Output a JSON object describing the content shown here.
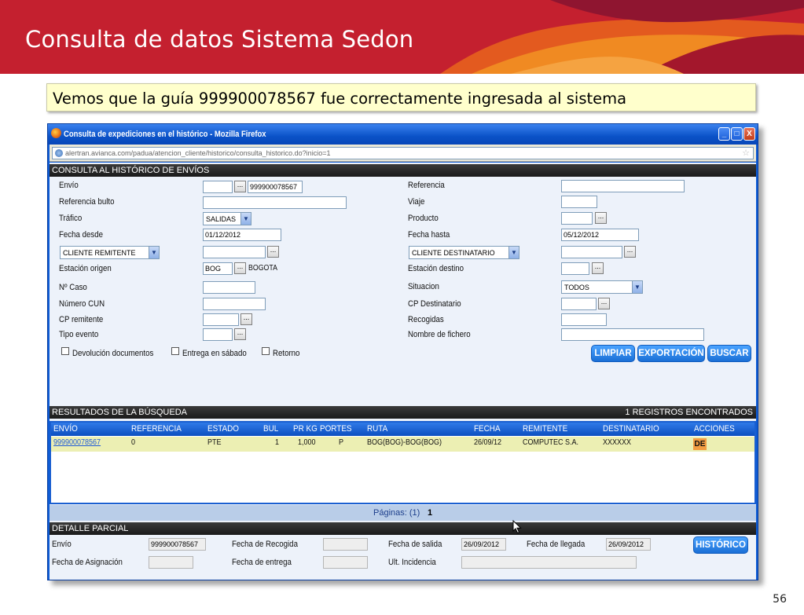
{
  "slide": {
    "title": "Consulta de datos Sistema Sedon",
    "callout": "Vemos que la guía 999900078567 fue correctamente ingresada al sistema",
    "page_number": "56"
  },
  "window": {
    "title": "Consulta de expediciones en el histórico - Mozilla Firefox",
    "url": "alertran.avianca.com/padua/atencion_cliente/historico/consulta_historico.do?inicio=1",
    "buttons": [
      "_",
      "□",
      "X"
    ]
  },
  "search": {
    "header": "CONSULTA AL HISTÓRICO DE ENVÍOS",
    "labels": {
      "envio": "Envío",
      "referencia_bulto": "Referencia bulto",
      "trafico": "Tráfico",
      "fecha_desde": "Fecha desde",
      "estacion_origen": "Estación origen",
      "n_caso": "Nº Caso",
      "numero_cun": "Número CUN",
      "cp_remitente": "CP remitente",
      "tipo_evento": "Tipo evento",
      "referencia": "Referencia",
      "viaje": "Viaje",
      "producto": "Producto",
      "fecha_hasta": "Fecha hasta",
      "estacion_destino": "Estación destino",
      "situacion": "Situacion",
      "cp_destinatario": "CP Destinatario",
      "recogidas": "Recogidas",
      "nombre_fichero": "Nombre de fichero"
    },
    "values": {
      "envio": "999900078567",
      "trafico": "SALIDAS",
      "fecha_desde": "01/12/2012",
      "fecha_hasta": "05/12/2012",
      "estacion_origen_code": "BOG",
      "estacion_origen_name": "BOGOTA",
      "situacion": "TODOS",
      "cliente_remitente": "CLIENTE REMITENTE",
      "cliente_destinatario": "CLIENTE DESTINATARIO"
    },
    "checkboxes": [
      "Devolución documentos",
      "Entrega en sábado",
      "Retorno"
    ],
    "dots_label": "...",
    "buttons": {
      "limpiar": "LIMPIAR",
      "exportacion": "EXPORTACIÓN",
      "buscar": "BUSCAR"
    }
  },
  "results": {
    "header": "RESULTADOS DE LA BÚSQUEDA",
    "count": "1 REGISTROS ENCONTRADOS",
    "columns": [
      "ENVÍO",
      "REFERENCIA",
      "ESTADO",
      "BUL",
      "PR KG",
      "PORTES",
      "RUTA",
      "FECHA",
      "REMITENTE",
      "DESTINATARIO",
      "ACCIONES"
    ],
    "rows": [
      [
        "999900078567",
        "0",
        "PTE",
        "1",
        "1,000",
        "P",
        "BOG(BOG)-BOG(BOG)",
        "26/09/12",
        "COMPUTEC S.A.",
        "XXXXXX",
        "DE"
      ]
    ],
    "pages_label": "Páginas: (1)",
    "current_page": "1"
  },
  "detail": {
    "header": "DETALLE PARCIAL",
    "labels": {
      "envio": "Envío",
      "fecha_asignacion": "Fecha de Asignación",
      "fecha_recogida": "Fecha de Recogida",
      "fecha_entrega": "Fecha de entrega",
      "fecha_salida": "Fecha de salida",
      "ult_incidencia": "Ult. Incidencia",
      "fecha_llegada": "Fecha de llegada"
    },
    "values": {
      "envio": "999900078567",
      "fecha_salida": "26/09/2012",
      "fecha_llegada": "26/09/2012"
    },
    "historico_button": "HISTÓRICO"
  }
}
